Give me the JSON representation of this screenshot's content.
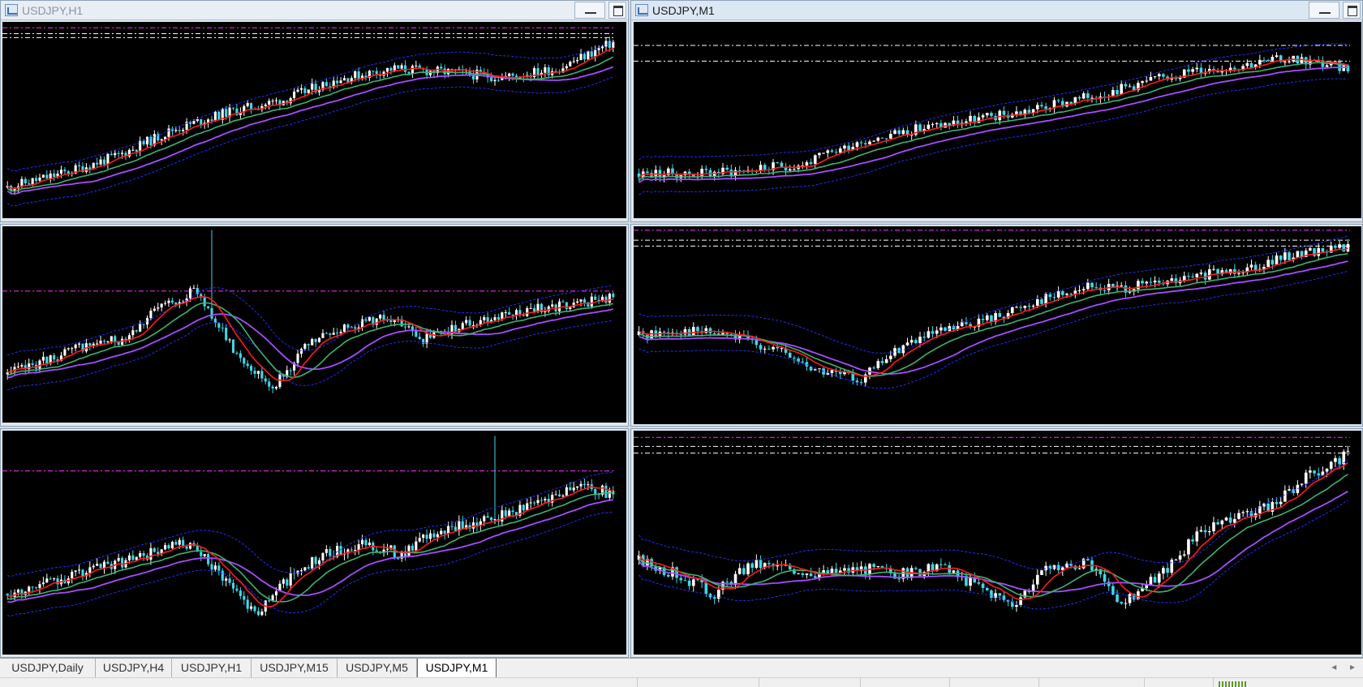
{
  "windows": [
    {
      "id": "w1",
      "title": "USDJPY,H1",
      "active": false
    },
    {
      "id": "w2",
      "title": "USDJPY,M1",
      "active": true
    }
  ],
  "tabs": [
    {
      "label": "USDJPY,Daily",
      "active": false
    },
    {
      "label": "USDJPY,H4",
      "active": false
    },
    {
      "label": "USDJPY,H1",
      "active": false
    },
    {
      "label": "USDJPY,M15",
      "active": false
    },
    {
      "label": "USDJPY,M5",
      "active": false
    },
    {
      "label": "USDJPY,M1",
      "active": true
    }
  ],
  "tab_scroll": {
    "left": "◂",
    "right": "▸"
  },
  "colors": {
    "chart_bg": "#000000",
    "bull_candle": "#ffffff",
    "bear_candle": "#40d8e8",
    "ma_fast": "#ff1a1a",
    "ma_mid": "#3cb371",
    "ma_slow": "#a64dff",
    "band": "#1f2fff",
    "level_magenta": "#ff33ff",
    "level_white": "#ffffff"
  },
  "charts": [
    {
      "name": "chart-top-left",
      "seed": 11,
      "bars": 170,
      "shape": [
        0.12,
        0.2,
        0.3,
        0.45,
        0.55,
        0.62,
        0.74,
        0.8,
        0.78,
        0.75,
        0.8,
        0.95
      ],
      "levels": [
        "magenta",
        "white",
        "white"
      ],
      "levelY": [
        0.03,
        0.06,
        0.08
      ]
    },
    {
      "name": "chart-top-right",
      "seed": 23,
      "bars": 170,
      "shape": [
        0.2,
        0.2,
        0.22,
        0.25,
        0.38,
        0.45,
        0.5,
        0.55,
        0.62,
        0.7,
        0.78,
        0.82,
        0.86,
        0.8
      ],
      "levels": [
        "white",
        "white"
      ],
      "levelY": [
        0.12,
        0.2
      ]
    },
    {
      "name": "chart-mid-left",
      "seed": 37,
      "bars": 170,
      "shape": [
        0.22,
        0.3,
        0.38,
        0.42,
        0.6,
        0.7,
        0.35,
        0.15,
        0.4,
        0.5,
        0.55,
        0.42,
        0.5,
        0.55,
        0.6,
        0.62,
        0.66
      ],
      "levels": [
        "magenta"
      ],
      "levelY": [
        0.33
      ],
      "spike": 0.34
    },
    {
      "name": "chart-mid-right",
      "seed": 41,
      "bars": 170,
      "shape": [
        0.45,
        0.48,
        0.45,
        0.38,
        0.25,
        0.2,
        0.4,
        0.48,
        0.55,
        0.65,
        0.72,
        0.72,
        0.75,
        0.8,
        0.85,
        0.92,
        0.95
      ],
      "levels": [
        "magenta",
        "white",
        "white"
      ],
      "levelY": [
        0.02,
        0.07,
        0.1
      ]
    },
    {
      "name": "chart-bot-left",
      "seed": 53,
      "bars": 170,
      "shape": [
        0.25,
        0.3,
        0.35,
        0.4,
        0.45,
        0.5,
        0.35,
        0.15,
        0.35,
        0.45,
        0.5,
        0.45,
        0.55,
        0.6,
        0.65,
        0.72,
        0.8,
        0.75
      ],
      "levels": [
        "magenta"
      ],
      "levelY": [
        0.18
      ],
      "spike": 0.8
    },
    {
      "name": "chart-bot-right",
      "seed": 67,
      "bars": 170,
      "shape": [
        0.42,
        0.35,
        0.25,
        0.4,
        0.38,
        0.35,
        0.38,
        0.35,
        0.38,
        0.3,
        0.2,
        0.38,
        0.4,
        0.2,
        0.35,
        0.55,
        0.62,
        0.7,
        0.85,
        0.95
      ],
      "levels": [
        "magenta",
        "white",
        "white"
      ],
      "levelY": [
        0.03,
        0.07,
        0.1
      ]
    }
  ]
}
